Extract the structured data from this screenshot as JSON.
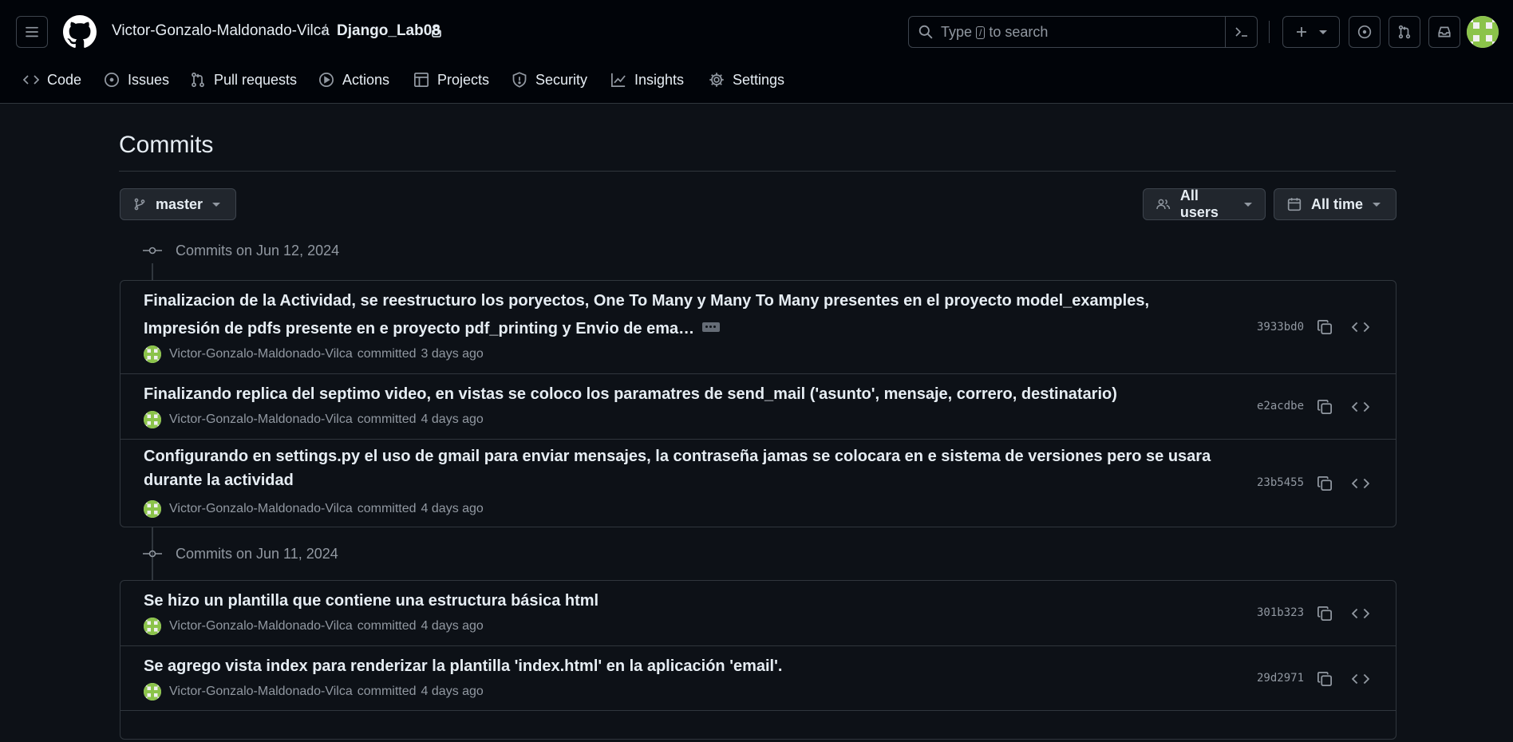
{
  "header": {
    "owner": "Victor-Gonzalo-Maldonado-Vilca",
    "separator": "/",
    "repo": "Django_Lab08",
    "search": {
      "prefix": "Type",
      "key": "/",
      "suffix": "to search"
    },
    "icons": [
      "menu-icon",
      "github-logo-icon",
      "lock-icon",
      "search-icon",
      "command-palette-icon",
      "plus-icon",
      "issues-icon",
      "pull-requests-icon",
      "inbox-icon"
    ]
  },
  "nav": {
    "items": [
      {
        "label": "Code",
        "icon": "code-icon"
      },
      {
        "label": "Issues",
        "icon": "issue-opened-icon"
      },
      {
        "label": "Pull requests",
        "icon": "git-pull-request-icon"
      },
      {
        "label": "Actions",
        "icon": "play-icon"
      },
      {
        "label": "Projects",
        "icon": "table-icon"
      },
      {
        "label": "Security",
        "icon": "shield-icon"
      },
      {
        "label": "Insights",
        "icon": "graph-icon"
      },
      {
        "label": "Settings",
        "icon": "gear-icon"
      }
    ]
  },
  "main": {
    "title": "Commits",
    "branch": "master",
    "users_filter": "All users",
    "time_filter": "All time",
    "groups": [
      {
        "heading": "Commits on Jun 12, 2024",
        "commits": [
          {
            "line1": "Finalizacion de la Actividad, se reestructuro los poryectos, One To Many y Many To Many presentes en el proyecto model_examples,",
            "line2": "Impresión de pdfs presente en e proyecto pdf_printing y Envio de ema…",
            "author": "Victor-Gonzalo-Maldonado-Vilca",
            "action": "committed",
            "when": "3 days ago",
            "sha": "3933bd0"
          },
          {
            "line1": "Finalizando replica del septimo video, en vistas se coloco los paramatres de send_mail ('asunto', mensaje, correro, destinatario)",
            "author": "Victor-Gonzalo-Maldonado-Vilca",
            "action": "committed",
            "when": "4 days ago",
            "sha": "e2acdbe"
          },
          {
            "line1": "Configurando en settings.py el uso de gmail para enviar mensajes, la contraseña jamas se colocara en e sistema de versiones pero se usara",
            "line2": "durante la actividad",
            "author": "Victor-Gonzalo-Maldonado-Vilca",
            "action": "committed",
            "when": "4 days ago",
            "sha": "23b5455"
          }
        ]
      },
      {
        "heading": "Commits on Jun 11, 2024",
        "commits": [
          {
            "line1": "Se hizo un plantilla que contiene una estructura básica html",
            "author": "Victor-Gonzalo-Maldonado-Vilca",
            "action": "committed",
            "when": "4 days ago",
            "sha": "301b323"
          },
          {
            "line1": "Se agrego vista index para renderizar la plantilla 'index.html' en la aplicación 'email'.",
            "author": "Victor-Gonzalo-Maldonado-Vilca",
            "action": "committed",
            "when": "4 days ago",
            "sha": "29d2971"
          }
        ]
      }
    ]
  },
  "colors": {
    "bg": "#0d1117",
    "header_bg": "#010409",
    "border": "#30363d",
    "text": "#e6edf3",
    "muted": "#9198a1",
    "avatar_green": "#8bc34a"
  }
}
